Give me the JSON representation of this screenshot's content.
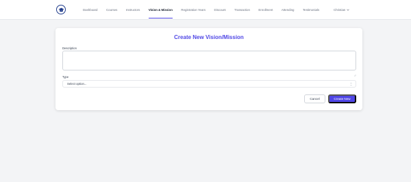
{
  "brand": {
    "logo_icon": "graduation-cap-icon",
    "color": "#1e3a8a"
  },
  "nav": {
    "items": [
      {
        "label": "Dashboard"
      },
      {
        "label": "Courses"
      },
      {
        "label": "Instructors"
      },
      {
        "label": "Vision & Mission",
        "active": true
      },
      {
        "label": "Registration Years"
      },
      {
        "label": "Discount"
      },
      {
        "label": "Transaction"
      },
      {
        "label": "Enrollment"
      },
      {
        "label": "Attending"
      },
      {
        "label": "Testimonials"
      }
    ],
    "user_name": "Christian",
    "user_chevron_icon": "chevron-down-icon"
  },
  "form": {
    "title": "Create New Vision/Mission",
    "description_label": "Description",
    "description_value": "",
    "type_label": "Type",
    "type_selected": "Select option...",
    "cancel_label": "Cancel",
    "create_label": "Create New"
  },
  "colors": {
    "accent": "#4f46e5",
    "background": "#f3f4f6"
  }
}
